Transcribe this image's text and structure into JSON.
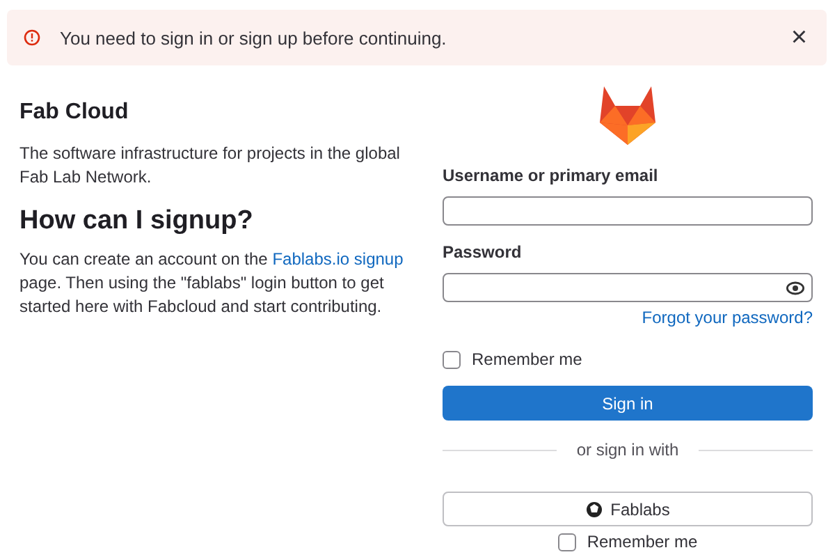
{
  "alert": {
    "message": "You need to sign in or sign up before continuing.",
    "close": "×"
  },
  "intro": {
    "title": "Fab Cloud",
    "description": "The software infrastructure for projects in the global Fab Lab Network.",
    "heading": "How can I signup?",
    "text_before": "You can create an account on the ",
    "link": "Fablabs.io signup",
    "text_after": " page. Then using the \"fablabs\" login button to get started here with Fabcloud and start contributing."
  },
  "form": {
    "username_label": "Username or primary email",
    "password_label": "Password",
    "forgot": "Forgot your password?",
    "remember": {
      "label": "Remember me",
      "checked": false
    },
    "submit": "Sign in",
    "divider": "or sign in with",
    "provider": "Fablabs",
    "provider_remember": {
      "label": "Remember me",
      "checked": false
    }
  }
}
